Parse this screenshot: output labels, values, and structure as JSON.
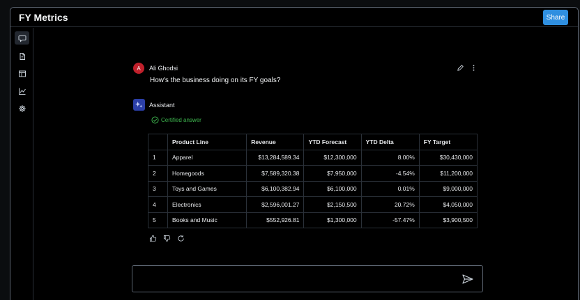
{
  "app": {
    "title": "FY Metrics",
    "share_label": "Share"
  },
  "sidebar": {
    "items": [
      {
        "icon": "chat-icon",
        "active": true
      },
      {
        "icon": "document-icon",
        "active": false
      },
      {
        "icon": "table-icon",
        "active": false
      },
      {
        "icon": "chart-icon",
        "active": false
      },
      {
        "icon": "gear-icon",
        "active": false
      }
    ]
  },
  "conversation": {
    "user": {
      "initial": "A",
      "name": "Ali Ghodsi",
      "message": "How's the business doing on its FY goals?"
    },
    "assistant": {
      "name": "Assistant",
      "certified_label": "Certified answer"
    }
  },
  "table": {
    "headers": [
      "",
      "Product Line",
      "Revenue",
      "YTD Forecast",
      "YTD Delta",
      "FY Target"
    ],
    "rows": [
      [
        "1",
        "Apparel",
        "$13,284,589.34",
        "$12,300,000",
        "8.00%",
        "$30,430,000"
      ],
      [
        "2",
        "Homegoods",
        "$7,589,320.38",
        "$7,950,000",
        "-4.54%",
        "$11,200,000"
      ],
      [
        "3",
        "Toys and Games",
        "$6,100,382.94",
        "$6,100,000",
        "0.01%",
        "$9,000,000"
      ],
      [
        "4",
        "Electronics",
        "$2,596,001.27",
        "$2,150,500",
        "20.72%",
        "$4,050,000"
      ],
      [
        "5",
        "Books and Music",
        "$552,926.81",
        "$1,300,000",
        "-57.47%",
        "$3,900,500"
      ]
    ]
  },
  "composer": {
    "placeholder": ""
  },
  "colors": {
    "accent": "#2f8fe0",
    "certified": "#3fb950",
    "user_avatar": "#c0202b",
    "assistant_avatar": "#2b3fa8"
  }
}
